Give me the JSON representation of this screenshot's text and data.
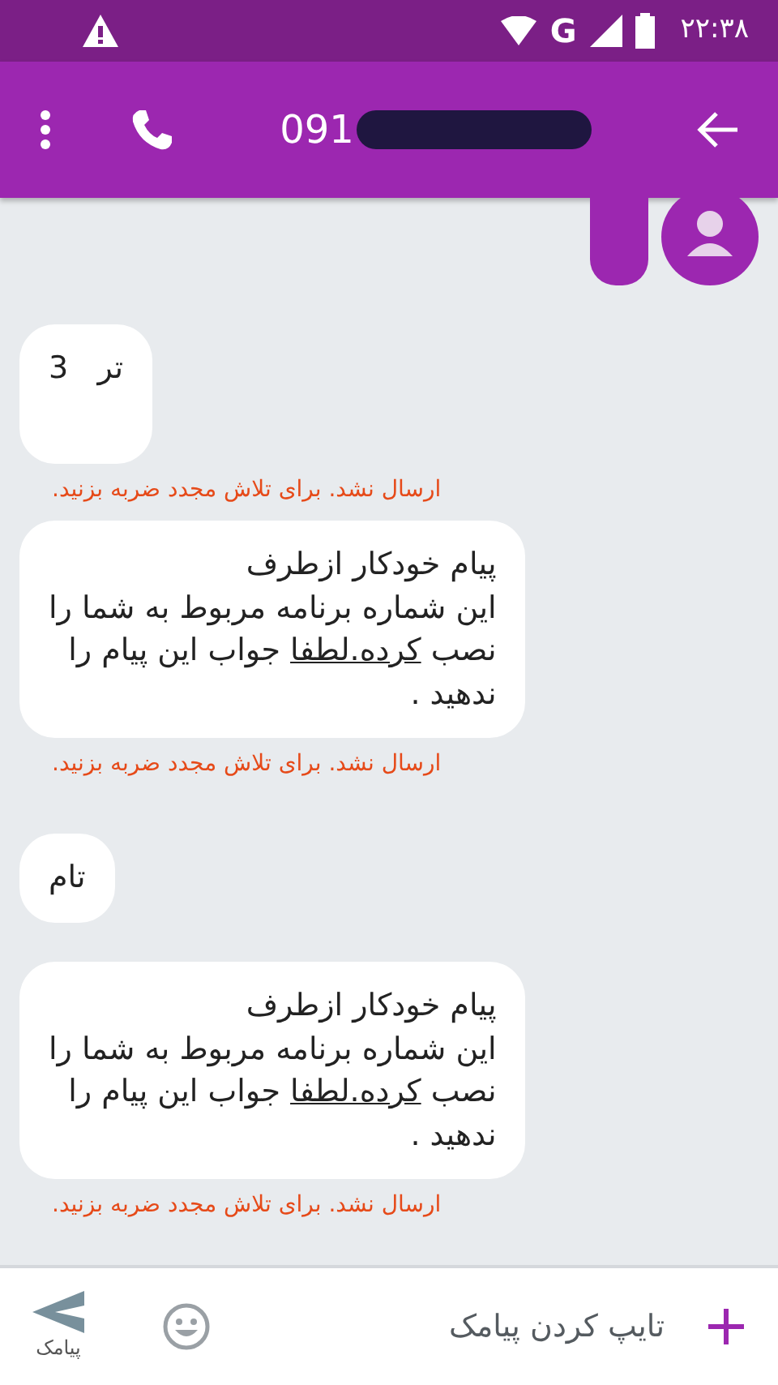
{
  "status_bar": {
    "time": "۲۲:۳۸",
    "network": "G"
  },
  "toolbar": {
    "title": "091"
  },
  "messages": [
    {
      "kind": "stub"
    },
    {
      "kind": "text",
      "lines": [
        [
          {
            "text": "تر   3",
            "underlined": false
          }
        ]
      ],
      "error": "ارسال نشد. برای تلاش مجدد ضربه بزنید."
    },
    {
      "kind": "text",
      "lines": [
        [
          {
            "text": "پیام خودکار ازطرف",
            "underlined": false
          }
        ],
        [
          {
            "text": "این شماره برنامه مربوط به شما را",
            "underlined": false
          }
        ],
        [
          {
            "text": "نصب ",
            "underlined": false
          },
          {
            "text": "کرده.لطفا",
            "underlined": true
          },
          {
            "text": " جواب این پیام را",
            "underlined": false
          }
        ],
        [
          {
            "text": "ندهید .",
            "underlined": false
          }
        ]
      ],
      "error": "ارسال نشد. برای تلاش مجدد ضربه بزنید."
    },
    {
      "kind": "text",
      "lines": [
        [
          {
            "text": "تام",
            "underlined": false
          }
        ]
      ]
    },
    {
      "kind": "text",
      "lines": [
        [
          {
            "text": "پیام خودکار ازطرف",
            "underlined": false
          }
        ],
        [
          {
            "text": "این شماره برنامه مربوط به شما را",
            "underlined": false
          }
        ],
        [
          {
            "text": "نصب ",
            "underlined": false
          },
          {
            "text": "کرده.لطفا",
            "underlined": true
          },
          {
            "text": " جواب این پیام را",
            "underlined": false
          }
        ],
        [
          {
            "text": "ندهید .",
            "underlined": false
          }
        ]
      ],
      "error": "ارسال نشد. برای تلاش مجدد ضربه بزنید."
    }
  ],
  "composer": {
    "placeholder": "تایپ کردن پیامک",
    "send_label": "پیامک"
  }
}
